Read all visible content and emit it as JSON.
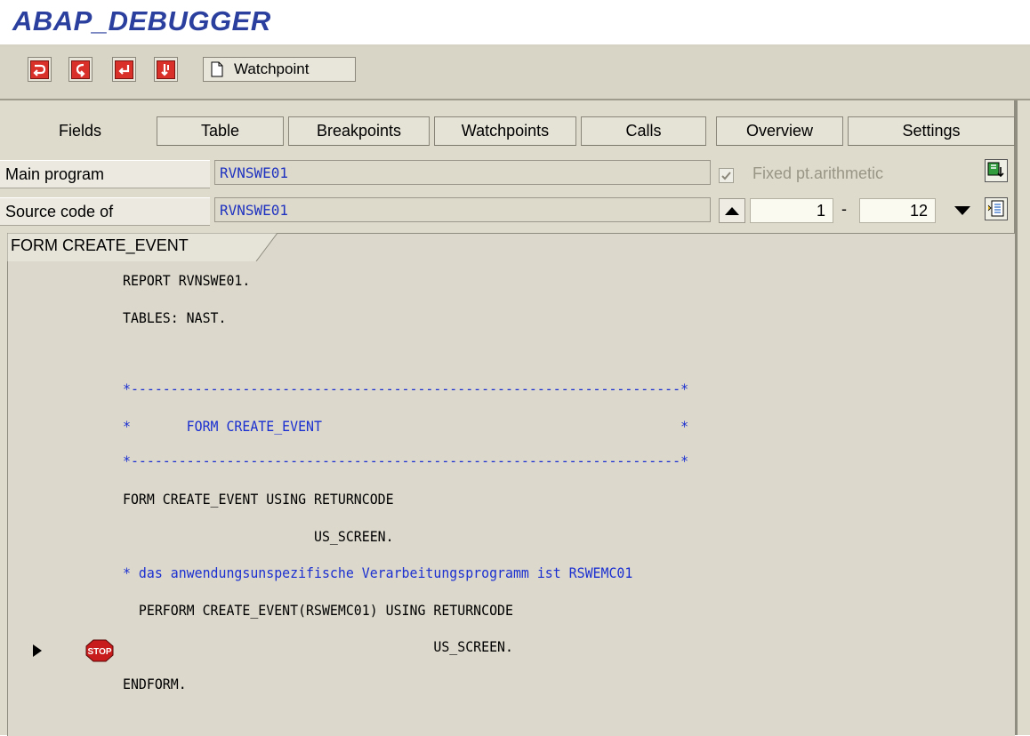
{
  "app_title": "ABAP_DEBUGGER",
  "toolbar": {
    "buttons": [
      {
        "name": "single-step-icon"
      },
      {
        "name": "execute-icon"
      },
      {
        "name": "return-icon"
      },
      {
        "name": "continue-icon"
      }
    ],
    "watchpoint_label": "Watchpoint"
  },
  "tabs": [
    {
      "label": "Fields",
      "active": true
    },
    {
      "label": "Table"
    },
    {
      "label": "Breakpoints"
    },
    {
      "label": "Watchpoints"
    },
    {
      "label": "Calls"
    },
    {
      "label": "Overview"
    },
    {
      "label": "Settings"
    }
  ],
  "main_program": {
    "label": "Main program",
    "value": "RVNSWE01"
  },
  "source_code": {
    "label": "Source code of",
    "value": "RVNSWE01"
  },
  "fixed_pt": {
    "label": "Fixed pt.arithmetic",
    "checked": true
  },
  "line_range": {
    "from": "1",
    "separator": "-",
    "to": "12"
  },
  "code_tab_label": "FORM CREATE_EVENT",
  "code_lines": [
    {
      "text": "REPORT RVNSWE01.",
      "comment": false
    },
    {
      "text": "TABLES: NAST.",
      "comment": false
    },
    {
      "text": "",
      "comment": false
    },
    {
      "text": "*---------------------------------------------------------------------*",
      "comment": true
    },
    {
      "text": "*       FORM CREATE_EVENT                                             *",
      "comment": true
    },
    {
      "text": "*---------------------------------------------------------------------*",
      "comment": true
    },
    {
      "text": "FORM CREATE_EVENT USING RETURNCODE",
      "comment": false
    },
    {
      "text": "                        US_SCREEN.",
      "comment": false
    },
    {
      "text": "* das anwendungsunspezifische Verarbeitungsprogramm ist RSWEMC01",
      "comment": true
    },
    {
      "text": "  PERFORM CREATE_EVENT(RSWEMC01) USING RETURNCODE",
      "comment": false
    },
    {
      "text": "                                       US_SCREEN.",
      "comment": false
    },
    {
      "text": "ENDFORM.",
      "comment": false
    }
  ],
  "breakpoint_label": "STOP",
  "colors": {
    "title": "#2a3f9e",
    "comment": "#1b2fd0",
    "field_text": "#1f33c0"
  }
}
